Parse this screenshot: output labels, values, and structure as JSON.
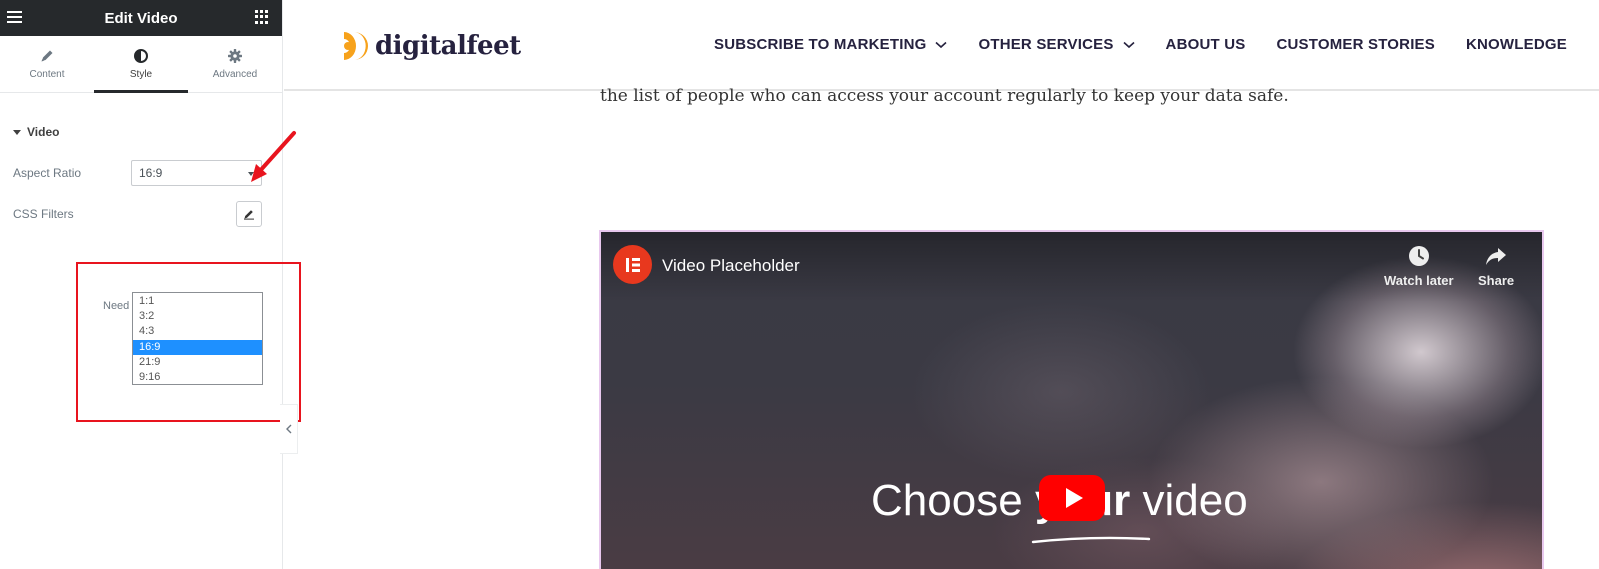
{
  "panel": {
    "title": "Edit Video",
    "tabs": [
      {
        "label": "Content",
        "icon": "pencil-icon"
      },
      {
        "label": "Style",
        "icon": "half-circle-icon"
      },
      {
        "label": "Advanced",
        "icon": "gear-icon"
      }
    ],
    "active_tab": "Style",
    "section_title": "Video",
    "aspect_ratio_label": "Aspect Ratio",
    "aspect_ratio_value": "16:9",
    "css_filters_label": "CSS Filters",
    "need_label": "Need",
    "aspect_options": [
      "1:1",
      "3:2",
      "4:3",
      "16:9",
      "21:9",
      "9:16"
    ],
    "selected_option": "16:9"
  },
  "site": {
    "logo_text": "digitalfeet",
    "logo_color": "#f7a21b",
    "nav": [
      {
        "label": "SUBSCRIBE TO MARKETING",
        "has_dropdown": true
      },
      {
        "label": "OTHER SERVICES",
        "has_dropdown": true
      },
      {
        "label": "ABOUT US",
        "has_dropdown": false
      },
      {
        "label": "CUSTOMER STORIES",
        "has_dropdown": false
      },
      {
        "label": "KNOWLEDGE",
        "has_dropdown": false
      }
    ],
    "body_text": "the list of people who can access your account regularly to keep your data safe."
  },
  "video": {
    "title": "Video Placeholder",
    "watch_later": "Watch later",
    "share": "Share",
    "overlay_prefix": "Choose ",
    "overlay_bold": "your",
    "overlay_suffix": " video"
  },
  "colors": {
    "annotation_red": "#e8141e",
    "panel_header": "#26292c",
    "selected_option_bg": "#1e90ff",
    "youtube_red": "#ff0000",
    "elementor_red": "#e8381e"
  }
}
